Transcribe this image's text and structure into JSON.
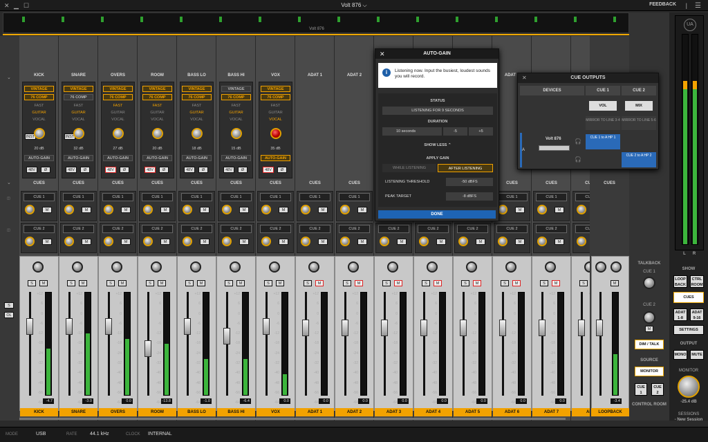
{
  "titlebar": {
    "title": "Volt 876",
    "feedback": "FEEDBACK",
    "chevron": "⌵"
  },
  "overview": {
    "label": "Volt 876"
  },
  "colors": {
    "accent": "#f2a200",
    "meter": "#3cb53c",
    "blue": "#1e64b4"
  },
  "channels": [
    {
      "name": "KICK",
      "type": "in",
      "plugins": [
        "VINTAGE",
        "76 COMP"
      ],
      "texts": [
        "FAST",
        "GUITAR",
        "VOCAL"
      ],
      "hl": [
        true,
        true,
        false,
        true,
        false
      ],
      "extra": "INST",
      "gain": "20 dB",
      "autogain": "AUTO-GAIN",
      "p48": "48V",
      "phase": "Ø",
      "p48on": false,
      "vol": "-4.7",
      "meter": 0.45
    },
    {
      "name": "SNARE",
      "type": "in",
      "plugins": [
        "VINTAGE",
        "76 COMP"
      ],
      "texts": [
        "FAST",
        "GUITAR",
        "VOCAL"
      ],
      "hl": [
        true,
        false,
        false,
        true,
        false
      ],
      "extra": "INST",
      "gain": "32 dB",
      "autogain": "AUTO-GAIN",
      "p48": "48V",
      "phase": "Ø",
      "p48on": false,
      "vol": "-3.0",
      "meter": 0.6
    },
    {
      "name": "OVERS",
      "type": "in",
      "plugins": [
        "VINTAGE",
        "76 COMP"
      ],
      "texts": [
        "FAST",
        "GUITAR",
        "VOCAL"
      ],
      "hl": [
        true,
        true,
        true,
        false,
        false
      ],
      "extra": "",
      "gain": "27 dB",
      "autogain": "AUTO-GAIN",
      "p48": "48V",
      "phase": "Ø",
      "p48on": true,
      "vol": "0.0",
      "meter": 0.55
    },
    {
      "name": "ROOM",
      "type": "in",
      "plugins": [
        "VINTAGE",
        "76 COMP"
      ],
      "texts": [
        "FAST",
        "GUITAR",
        "VOCAL"
      ],
      "hl": [
        true,
        true,
        true,
        false,
        false
      ],
      "extra": "",
      "gain": "20 dB",
      "autogain": "AUTO-GAIN",
      "p48": "48V",
      "phase": "Ø",
      "p48on": true,
      "vol": "-13.8",
      "meter": 0.5
    },
    {
      "name": "BASS LO",
      "type": "in",
      "plugins": [
        "VINTAGE",
        "76 COMP"
      ],
      "texts": [
        "FAST",
        "GUITAR",
        "VOCAL"
      ],
      "hl": [
        true,
        true,
        false,
        true,
        false
      ],
      "extra": "",
      "gain": "18 dB",
      "autogain": "AUTO-GAIN",
      "p48": "48V",
      "phase": "Ø",
      "p48on": false,
      "vol": "-1.0",
      "meter": 0.35
    },
    {
      "name": "BASS HI",
      "type": "in",
      "plugins": [
        "VINTAGE",
        "76 COMP"
      ],
      "texts": [
        "FAST",
        "GUITAR",
        "VOCAL"
      ],
      "hl": [
        false,
        true,
        false,
        true,
        false
      ],
      "extra": "",
      "gain": "15 dB",
      "autogain": "AUTO-GAIN",
      "p48": "48V",
      "phase": "Ø",
      "p48on": false,
      "vol": "-6.4",
      "meter": 0.35
    },
    {
      "name": "VOX",
      "type": "in",
      "plugins": [
        "VINTAGE",
        "76 COMP"
      ],
      "texts": [
        "FAST",
        "GUITAR",
        "VOCAL"
      ],
      "hl": [
        true,
        true,
        false,
        false,
        true
      ],
      "extra": "",
      "gain": "35 dB",
      "autogain": "AUTO-GAIN",
      "p48": "48V",
      "phase": "Ø",
      "p48on": true,
      "vol": "0.0",
      "meter": 0.2,
      "red": true,
      "agon": true
    },
    {
      "name": "ADAT 1",
      "type": "adat",
      "vol": "0.0",
      "meter": 0
    },
    {
      "name": "ADAT 2",
      "type": "adat",
      "vol": "0.0",
      "meter": 0
    },
    {
      "name": "ADAT 3",
      "type": "adat",
      "vol": "0.0",
      "meter": 0
    },
    {
      "name": "ADAT 4",
      "type": "adat",
      "vol": "0.0",
      "meter": 0
    },
    {
      "name": "ADAT 5",
      "type": "adat",
      "vol": "0.0",
      "meter": 0
    },
    {
      "name": "ADAT 6",
      "type": "adat",
      "vol": "0.0",
      "meter": 0
    },
    {
      "name": "ADAT 7",
      "type": "adat",
      "vol": "0.0",
      "meter": 0
    },
    {
      "name": "ADA",
      "type": "adat",
      "vol": "",
      "meter": 0
    }
  ],
  "strip": {
    "cues": "CUES",
    "cue1": "CUE 1",
    "cue2": "CUE 2",
    "m": "M",
    "s": "S",
    "vl": "L",
    "vr": "R"
  },
  "left": {
    "s": "S",
    "ol": "OL"
  },
  "loopback": {
    "name": "LOOPBACK",
    "vol": "-3.4",
    "cues": "CUES"
  },
  "scale": [
    "+12",
    "6",
    "0",
    "-6",
    "-12",
    "-18",
    "-24",
    "-32",
    "-40",
    "-48",
    "-56",
    "-64"
  ],
  "autogain": {
    "title": "AUTO-GAIN",
    "message": "Listening now. Input the busiest, loudest sounds you will record.",
    "status_label": "STATUS",
    "status": "LISTENING FOR 9 SECONDS",
    "duration_label": "DURATION",
    "duration": "10 seconds",
    "minus": "-5",
    "plus": "+5",
    "showless": "SHOW LESS",
    "apply_label": "APPLY GAIN",
    "while": "WHILE LISTENING",
    "after": "AFTER LISTENING",
    "threshold_label": "LISTENING THRESHOLD",
    "threshold": "-50 dBFS",
    "peak_label": "PEAK TARGET",
    "peak": "-8 dBFS",
    "done": "DONE"
  },
  "cueout": {
    "title": "CUE OUTPUTS",
    "devices": "DEVICES",
    "cue1": "CUE 1",
    "cue2": "CUE 2",
    "vol": "VOL",
    "mix": "MIX",
    "mirror1": "MIRROR TO LINE 3-4",
    "mirror2": "MIRROR TO LINE 5-6",
    "device": "Volt 876",
    "rowlabel": "A",
    "dest1": "CUE 1 to A HP 1",
    "dest2": "CUE 2 to A HP 2"
  },
  "rightpanel": {
    "talkback": "TALKBACK",
    "cue1": "CUE 1",
    "cue2": "CUE 2",
    "m": "M",
    "dimtalk": "DIM / TALK",
    "source": "SOURCE",
    "monitor": "MONITOR",
    "cue1b": "CUE 1",
    "cue2b": "CUE 2",
    "control": "CONTROL ROOM"
  },
  "monpanel": {
    "l": "L",
    "r": "R",
    "show": "SHOW",
    "loopback": "LOOP BACK",
    "ctrlroom": "CTRL ROOM",
    "cues": "CUES",
    "adat18": "ADAT 1-8",
    "adat916": "ADAT 9-16",
    "settings": "SETTINGS",
    "output": "OUTPUT",
    "mono": "MONO",
    "mute": "MUTE",
    "monitor": "MONITOR",
    "monval": "-25.4 dB",
    "sessions": "SESSIONS",
    "session": "New Session"
  },
  "status": {
    "mode_l": "MODE",
    "mode": "USB",
    "rate_l": "RATE",
    "rate": "44.1 kHz",
    "clock_l": "CLOCK",
    "clock": "INTERNAL"
  }
}
